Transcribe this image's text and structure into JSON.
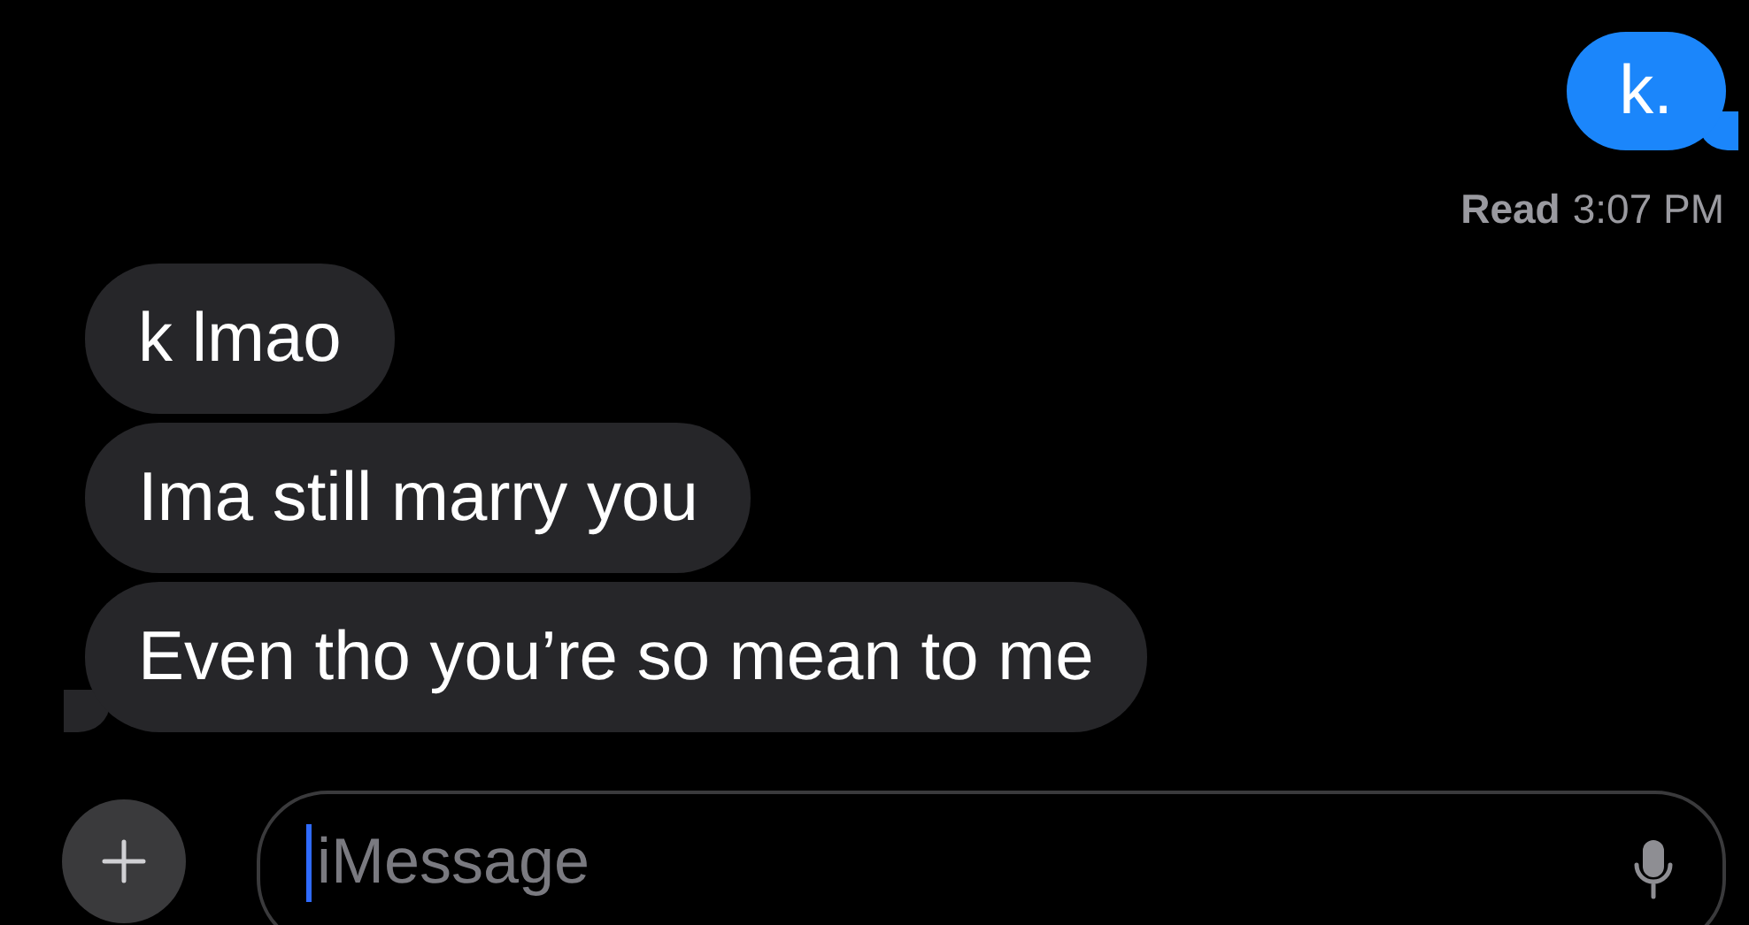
{
  "messages": [
    {
      "kind": "outgoing",
      "text": "k.",
      "tail": true
    },
    {
      "kind": "incoming",
      "text": "k lmao",
      "tail": false
    },
    {
      "kind": "incoming",
      "text": "Ima still marry you",
      "tail": false
    },
    {
      "kind": "incoming",
      "text": "Even tho you’re so mean to me",
      "tail": true
    }
  ],
  "receipt": {
    "label": "Read",
    "time": "3:07 PM"
  },
  "composer": {
    "placeholder": "iMessage"
  }
}
